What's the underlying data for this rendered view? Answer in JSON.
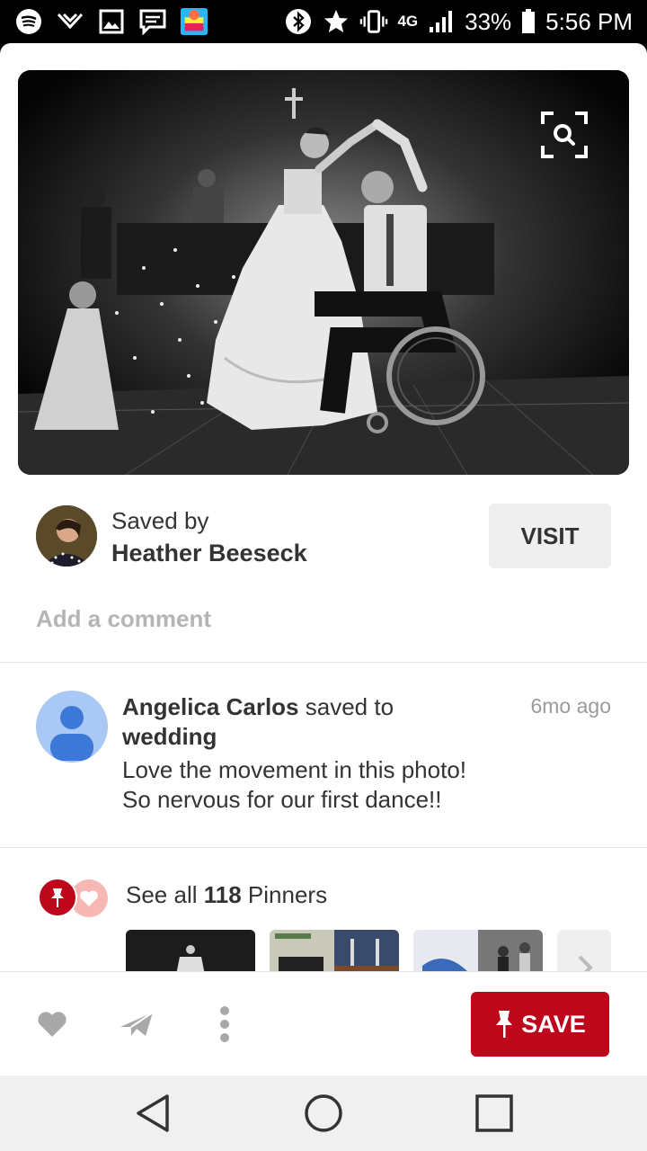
{
  "status_bar": {
    "battery": "33%",
    "time": "5:56 PM",
    "network": "4G"
  },
  "pin": {
    "saved_by_label": "Saved by",
    "saved_by_name": "Heather Beeseck",
    "visit_label": "VISIT",
    "comment_placeholder": "Add a comment"
  },
  "activity": {
    "user": "Angelica Carlos",
    "action": " saved to",
    "board": "wedding",
    "description_line1": "Love the movement in this photo!",
    "description_line2": "So nervous for our first dance!!",
    "time_ago": "6mo ago"
  },
  "pinners": {
    "prefix": "See all ",
    "count": "118",
    "suffix": " Pinners"
  },
  "actions": {
    "save_label": "SAVE"
  },
  "colors": {
    "brand_red": "#bd081c",
    "avatar_blue": "#a9c8f3",
    "heart_pink": "#f7b7b4"
  }
}
